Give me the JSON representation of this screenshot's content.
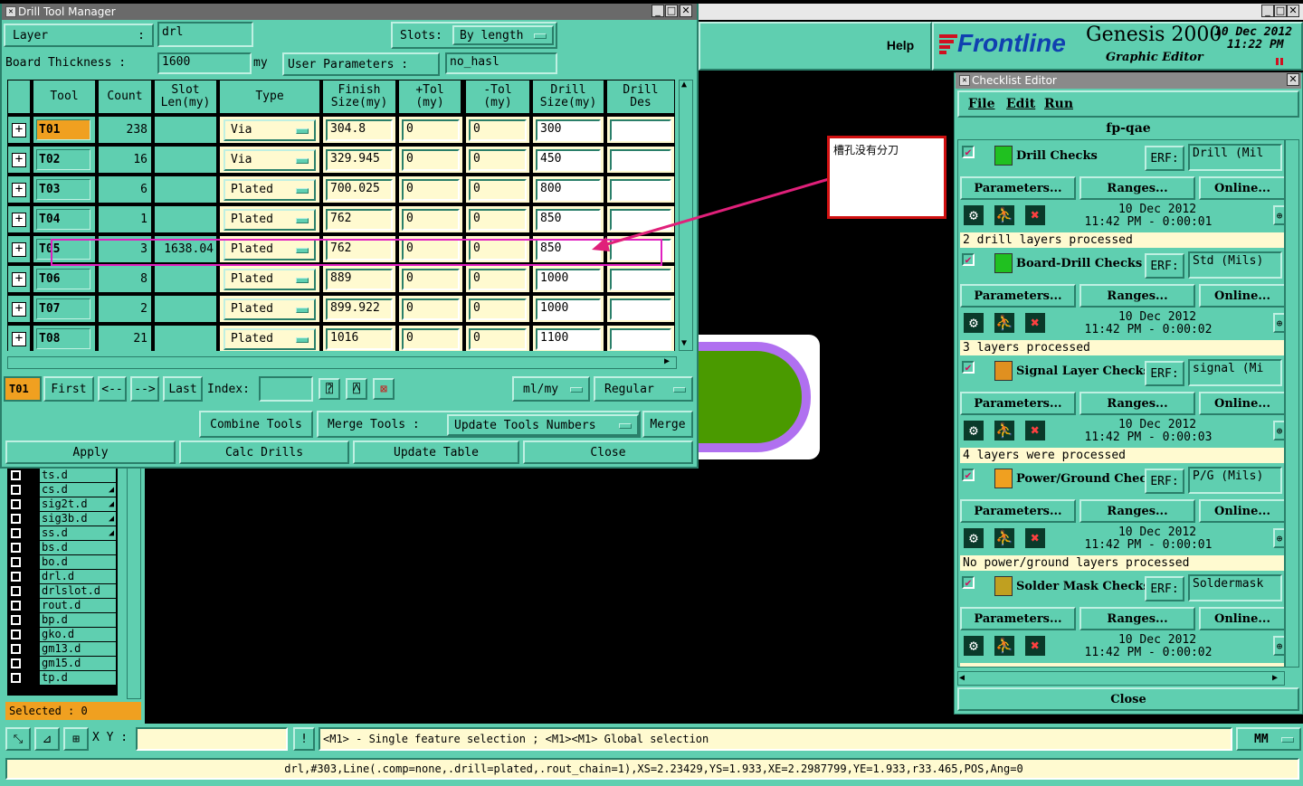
{
  "drill_window": {
    "title": "Drill Tool Manager",
    "layer_label": "Layer",
    "layer_colon": ":",
    "layer_value": "drl",
    "slots_label": "Slots:",
    "slots_value": "By length",
    "board_thickness_label": "Board Thickness :",
    "board_thickness_value": "1600",
    "board_thickness_unit": "my",
    "user_params_label": "User Parameters :",
    "user_params_value": "no_hasl",
    "columns": [
      "Tool",
      "Count",
      "Slot\nLen(my)",
      "Type",
      "Finish\nSize(my)",
      "+Tol\n(my)",
      "-Tol\n(my)",
      "Drill\nSize(my)",
      "Drill\nDes"
    ],
    "rows": [
      {
        "tool": "T01",
        "count": "238",
        "slot": "",
        "type": "Via",
        "finish": "304.8",
        "ptol": "0",
        "mtol": "0",
        "drill": "300",
        "des": ""
      },
      {
        "tool": "T02",
        "count": "16",
        "slot": "",
        "type": "Via",
        "finish": "329.945",
        "ptol": "0",
        "mtol": "0",
        "drill": "450",
        "des": ""
      },
      {
        "tool": "T03",
        "count": "6",
        "slot": "",
        "type": "Plated",
        "finish": "700.025",
        "ptol": "0",
        "mtol": "0",
        "drill": "800",
        "des": ""
      },
      {
        "tool": "T04",
        "count": "1",
        "slot": "",
        "type": "Plated",
        "finish": "762",
        "ptol": "0",
        "mtol": "0",
        "drill": "850",
        "des": ""
      },
      {
        "tool": "T05",
        "count": "3",
        "slot": "1638.04",
        "type": "Plated",
        "finish": "762",
        "ptol": "0",
        "mtol": "0",
        "drill": "850",
        "des": ""
      },
      {
        "tool": "T06",
        "count": "8",
        "slot": "",
        "type": "Plated",
        "finish": "889",
        "ptol": "0",
        "mtol": "0",
        "drill": "1000",
        "des": ""
      },
      {
        "tool": "T07",
        "count": "2",
        "slot": "",
        "type": "Plated",
        "finish": "899.922",
        "ptol": "0",
        "mtol": "0",
        "drill": "1000",
        "des": ""
      },
      {
        "tool": "T08",
        "count": "21",
        "slot": "",
        "type": "Plated",
        "finish": "1016",
        "ptol": "0",
        "mtol": "0",
        "drill": "1100",
        "des": ""
      }
    ],
    "nav": {
      "current": "T01",
      "first": "First",
      "prev": "<--",
      "next": "-->",
      "last": "Last",
      "index_label": "Index:",
      "units": "ml/my",
      "mode": "Regular"
    },
    "actions": {
      "combine": "Combine Tools",
      "merge_tools": "Merge Tools :",
      "update_numbers": "Update Tools Numbers",
      "merge": "Merge",
      "apply": "Apply",
      "calc": "Calc Drills",
      "update_table": "Update Table",
      "close": "Close"
    }
  },
  "annotation": {
    "note": "槽孔没有分刀"
  },
  "header": {
    "help": "Help",
    "brand": "Frontline",
    "product": "Genesis 2000",
    "subtitle": "Graphic Editor",
    "date": "10 Dec 2012",
    "time": "11:22 PM"
  },
  "checklist": {
    "title": "Checklist Editor",
    "menu": [
      "File",
      "Edit",
      "Run"
    ],
    "name": "fp-qae",
    "params_label": "Parameters...",
    "ranges_label": "Ranges...",
    "online_label": "Online...",
    "erf_label": "ERF:",
    "close": "Close",
    "items": [
      {
        "name": "Drill Checks",
        "erf": "Drill (Mil",
        "date": "10 Dec 2012",
        "time": "11:42 PM - 0:00:01",
        "status": "2 drill layers processed",
        "icon_color": "#20c020"
      },
      {
        "name": "Board-Drill Checks",
        "erf": "Std (Mils)",
        "date": "10 Dec 2012",
        "time": "11:42 PM - 0:00:02",
        "status": "3 layers processed",
        "icon_color": "#20c020"
      },
      {
        "name": "Signal Layer Checks",
        "erf": "signal (Mi",
        "date": "10 Dec 2012",
        "time": "11:42 PM - 0:00:03",
        "status": "4 layers were processed",
        "icon_color": "#e09020"
      },
      {
        "name": "Power/Ground Checks",
        "erf": "P/G (Mils)",
        "date": "10 Dec 2012",
        "time": "11:42 PM - 0:00:01",
        "status": "No power/ground layers processed",
        "icon_color": "#f0a020"
      },
      {
        "name": "Solder Mask Checks",
        "erf": "Soldermask",
        "date": "10 Dec 2012",
        "time": "11:42 PM - 0:00:02",
        "status": "",
        "icon_color": "#c0a020"
      }
    ]
  },
  "layers": {
    "items": [
      "ts.d",
      "cs.d",
      "sig2t.d",
      "sig3b.d",
      "ss.d",
      "bs.d",
      "bo.d",
      "drl.d",
      "drlslot.d",
      "rout.d",
      "bp.d",
      "gko.d",
      "gm13.d",
      "gm15.d",
      "tp.d"
    ],
    "marked": [
      false,
      true,
      true,
      true,
      true,
      false,
      false,
      false,
      false,
      false,
      false,
      false,
      false,
      false,
      false
    ],
    "selected_label": "Selected : 0"
  },
  "bottom": {
    "xy_label": "X Y :",
    "hint": "<M1> - Single feature selection ; <M1><M1> Global selection",
    "units": "MM",
    "status": "drl,#303,Line(.comp=none,.drill=plated,.rout_chain=1),XS=2.23429,YS=1.933,XE=2.2987799,YE=1.933,r33.465,POS,Ang=0"
  }
}
